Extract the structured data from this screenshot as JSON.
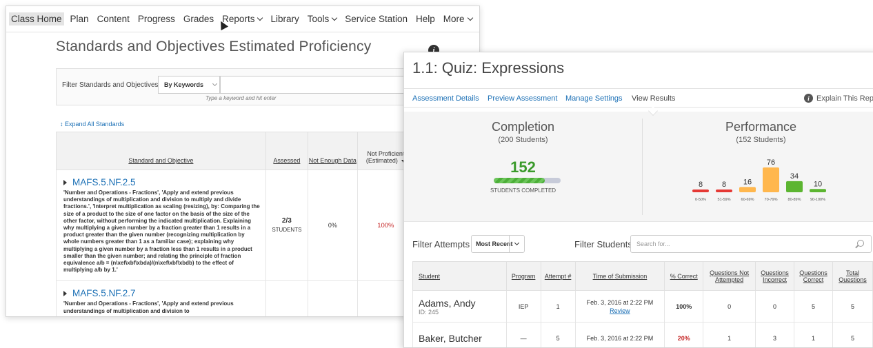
{
  "nav": {
    "items": [
      {
        "label": "Class Home",
        "dropdown": false,
        "active": true
      },
      {
        "label": "Plan",
        "dropdown": false
      },
      {
        "label": "Content",
        "dropdown": false
      },
      {
        "label": "Progress",
        "dropdown": false
      },
      {
        "label": "Grades",
        "dropdown": false
      },
      {
        "label": "Reports",
        "dropdown": true
      },
      {
        "label": "Library",
        "dropdown": false
      },
      {
        "label": "Tools",
        "dropdown": true
      },
      {
        "label": "Service Station",
        "dropdown": false
      },
      {
        "label": "Help",
        "dropdown": false
      },
      {
        "label": "More",
        "dropdown": true
      }
    ]
  },
  "standards": {
    "title": "Standards and Objectives Estimated Proficiency",
    "filter_label": "Filter Standards and Objectives:",
    "filter_select": "By Keywords",
    "filter_hint": "Type a keyword and hit enter",
    "expand_label": "Expand All Standards",
    "headers": {
      "standard": "Standard and Objective",
      "assessed": "Assessed",
      "not_enough": "Not Enough Data",
      "not_proficient": "Not Proficient (Estimated)"
    },
    "rows": [
      {
        "code": "MAFS.5.NF.2.5",
        "description": "'Number and Operations - Fractions', 'Apply and extend previous understandings of multiplication and division to multiply and divide fractions.', 'Interpret multiplication as scaling (resizing), by: Comparing the size of a product to the size of one factor on the basis of the size of the other factor, without performing the indicated multiplication. Explaining why multiplying a given number by a fraction greater than 1 results in a product greater than the given number (recognizing multiplication by whole numbers greater than 1 as a familiar case); explaining why multiplying a given number by a fraction less than 1 results in a product smaller than the given number; and relating the principle of fraction equivalence a/b = (n\\xef\\xbf\\xbda)/(n\\xef\\xbf\\xbdb) to the effect of multiplying a/b by 1.'",
        "assessed": "2/3",
        "assessed_unit": "STUDENTS",
        "not_enough": "0%",
        "not_proficient": "100%"
      },
      {
        "code": "MAFS.5.NF.2.7",
        "description": "'Number and Operations - Fractions', 'Apply and extend previous understandings of multiplication and division to",
        "assessed": "",
        "assessed_unit": "",
        "not_enough": "",
        "not_proficient": ""
      }
    ]
  },
  "quiz": {
    "title": "1.1: Quiz: Expressions",
    "tabs": [
      "Assessment Details",
      "Preview Assessment",
      "Manage Settings",
      "View Results"
    ],
    "explain": "Explain This Report",
    "completion": {
      "title": "Completion",
      "subtitle": "(200 Students)",
      "count": "152",
      "caption": "STUDENTS COMPLETED",
      "fraction": 0.76
    },
    "performance": {
      "title": "Performance",
      "subtitle": "(152 Students)"
    },
    "filter_attempts_label": "Filter Attempts",
    "filter_attempts_value": "Most Recent",
    "filter_students_label": "Filter Students",
    "filter_students_placeholder": "Search for...",
    "table": {
      "headers": [
        "Student",
        "Program",
        "Attempt #",
        "Time of Submission",
        "% Correct",
        "Questions Not Attempted",
        "Questions Incorrect",
        "Questions Correct",
        "Total Questions"
      ],
      "rows": [
        {
          "name": "Adams, Andy",
          "id": "ID: 245",
          "program": "IEP",
          "attempt": "1",
          "time": "Feb. 3, 2016 at 2:22 PM",
          "review": "Review",
          "pct": "100%",
          "not_attempted": "0",
          "incorrect": "0",
          "correct": "5",
          "total": "5"
        },
        {
          "name": "Baker, Butcher",
          "id": "",
          "program": "—",
          "attempt": "5",
          "time": "Feb. 3, 2016 at 2:22 PM",
          "review": "",
          "pct": "20%",
          "not_attempted": "1",
          "incorrect": "3",
          "correct": "1",
          "total": "5"
        }
      ]
    }
  },
  "chart_data": {
    "type": "bar",
    "categories": [
      "0-50%",
      "51-59%",
      "60-69%",
      "70-79%",
      "80-89%",
      "90-100%"
    ],
    "values": [
      8,
      8,
      16,
      76,
      34,
      10
    ],
    "colors": [
      "#e53935",
      "#e53935",
      "#ffb74d",
      "#ffb74d",
      "#5cb531",
      "#5cb531"
    ],
    "title": "Performance",
    "xlabel": "",
    "ylabel": ""
  }
}
